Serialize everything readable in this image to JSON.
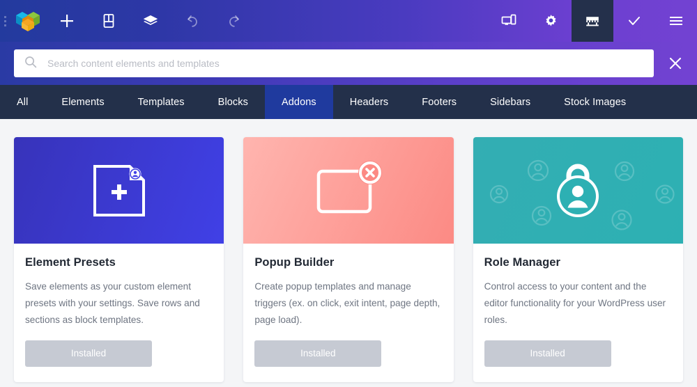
{
  "toolbar": {
    "logo_label": "builder-logo",
    "left_buttons": [
      {
        "name": "add-element-button",
        "icon": "plus-icon",
        "label": "Add"
      },
      {
        "name": "layout-button",
        "icon": "layout-icon",
        "label": "Layout"
      },
      {
        "name": "layers-button",
        "icon": "layers-icon",
        "label": "Layers"
      },
      {
        "name": "undo-button",
        "icon": "undo-icon",
        "label": "Undo"
      },
      {
        "name": "redo-button",
        "icon": "redo-icon",
        "label": "Redo"
      }
    ],
    "right_buttons": [
      {
        "name": "responsive-button",
        "icon": "responsive-devices-icon",
        "label": "Responsive",
        "active": false
      },
      {
        "name": "settings-button",
        "icon": "gear-icon",
        "label": "Settings",
        "active": false
      },
      {
        "name": "store-button",
        "icon": "store-icon",
        "label": "Store",
        "active": true
      },
      {
        "name": "save-button",
        "icon": "check-icon",
        "label": "Save",
        "active": false
      },
      {
        "name": "menu-button",
        "icon": "hamburger-icon",
        "label": "Menu",
        "active": false
      }
    ]
  },
  "search": {
    "placeholder": "Search content elements and templates",
    "value": "",
    "icon": "search-icon",
    "close_icon": "close-icon"
  },
  "tabs": [
    {
      "label": "All",
      "active": false
    },
    {
      "label": "Elements",
      "active": false
    },
    {
      "label": "Templates",
      "active": false
    },
    {
      "label": "Blocks",
      "active": false
    },
    {
      "label": "Addons",
      "active": true
    },
    {
      "label": "Headers",
      "active": false
    },
    {
      "label": "Footers",
      "active": false
    },
    {
      "label": "Sidebars",
      "active": false
    },
    {
      "label": "Stock Images",
      "active": false
    }
  ],
  "cards": [
    {
      "title": "Element Presets",
      "description": "Save elements as your custom element presets with your settings. Save rows and sections as block templates.",
      "button_label": "Installed",
      "art_icon": "page-with-plus-icon",
      "accent": "#4040e6"
    },
    {
      "title": "Popup Builder",
      "description": "Create popup templates and manage triggers (ex. on click, exit intent, page depth, page load).",
      "button_label": "Installed",
      "art_icon": "popup-window-close-icon",
      "accent": "#fc8a84"
    },
    {
      "title": "Role Manager",
      "description": "Control access to your content and the editor functionality for your WordPress user roles.",
      "button_label": "Installed",
      "art_icon": "lock-user-icon",
      "accent": "#2db0b3"
    }
  ],
  "colors": {
    "toolbar_start": "#233a9e",
    "toolbar_end": "#7342d2",
    "tabbar_bg": "#23304a",
    "tab_active_bg": "#1f3a9e",
    "active_tool_bg": "#24304b",
    "page_bg": "#f4f5f7",
    "installed_btn": "#c6cad3"
  }
}
